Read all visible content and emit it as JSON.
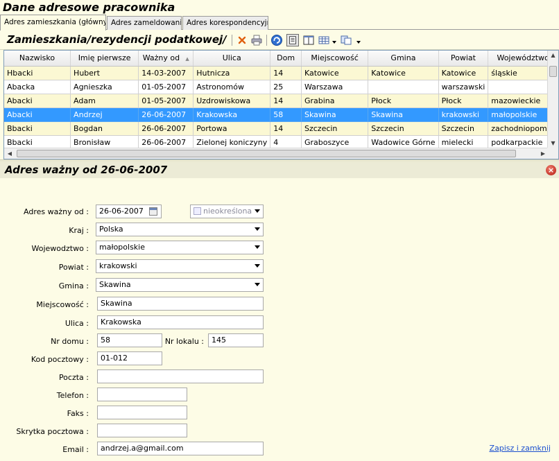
{
  "window": {
    "title": "Dane adresowe pracownika"
  },
  "tabs": [
    {
      "label": "Adres  zamieszkania (główny)",
      "active": true
    },
    {
      "label": "Adres zameldowania"
    },
    {
      "label": "Adres korespondencyjny"
    }
  ],
  "toolbar": {
    "title": "Zamieszkania/rezydencji podatkowej/",
    "icons": [
      "delete-icon",
      "print-icon",
      "refresh-icon",
      "report-icon",
      "columns-icon",
      "grid-layout-icon",
      "export-icon"
    ]
  },
  "grid": {
    "columns": [
      "Nazwisko",
      "Imię pierwsze",
      "Ważny od",
      "Ulica",
      "Dom",
      "Miejscowość",
      "Gmina",
      "Powiat",
      "Województwo"
    ],
    "rows": [
      [
        "Hbacki",
        "Hubert",
        "14-03-2007",
        "Hutnicza",
        "14",
        "Katowice",
        "Katowice",
        "Katowice",
        "śląskie"
      ],
      [
        "Abacka",
        "Agnieszka",
        "01-05-2007",
        "Astronomów",
        "25",
        "Warszawa",
        "",
        "warszawski",
        ""
      ],
      [
        "Abacki",
        "Adam",
        "01-05-2007",
        "Uzdrowiskowa",
        "14",
        "Grabina",
        "Płock",
        "Płock",
        "mazowieckie"
      ],
      [
        "Abacki",
        "Andrzej",
        "26-06-2007",
        "Krakowska",
        "58",
        "Skawina",
        "Skawina",
        "krakowski",
        "małopolskie"
      ],
      [
        "Bbacki",
        "Bogdan",
        "26-06-2007",
        "Portowa",
        "14",
        "Szczecin",
        "Szczecin",
        "Szczecin",
        "zachodniopomor"
      ],
      [
        "Bbacki",
        "Bronisław",
        "26-06-2007",
        "Zielonej koniczyny",
        "4",
        "Graboszyce",
        "Wadowice Górne",
        "mielecki",
        "podkarpackie"
      ]
    ],
    "selected_row": 3
  },
  "section": {
    "title": "Adres ważny od 26-06-2007"
  },
  "form": {
    "valid_from_label": "Adres ważny od :",
    "valid_from": "26-06-2007",
    "valid_to": "nieokreślona",
    "country_label": "Kraj :",
    "country": "Polska",
    "voivodeship_label": "Wojewodztwo :",
    "voivodeship": "małopolskie",
    "county_label": "Powiat :",
    "county": "krakowski",
    "commune_label": "Gmina :",
    "commune": "Skawina",
    "city_label": "Miejscowość :",
    "city": "Skawina",
    "street_label": "Ulica :",
    "street": "Krakowska",
    "house_label": "Nr domu :",
    "house": "58",
    "flat_label": "Nr lokalu :",
    "flat": "145",
    "postcode_label": "Kod pocztowy :",
    "postcode": "01-012",
    "post_label": "Poczta :",
    "post": "",
    "phone_label": "Telefon :",
    "phone": "",
    "fax_label": "Faks :",
    "fax": "",
    "pobox_label": "Skrytka pocztowa :",
    "pobox": "",
    "email_label": "Email  :",
    "email": "andrzej.a@gmail.com",
    "save_link": "Zapisz i zamknij"
  }
}
